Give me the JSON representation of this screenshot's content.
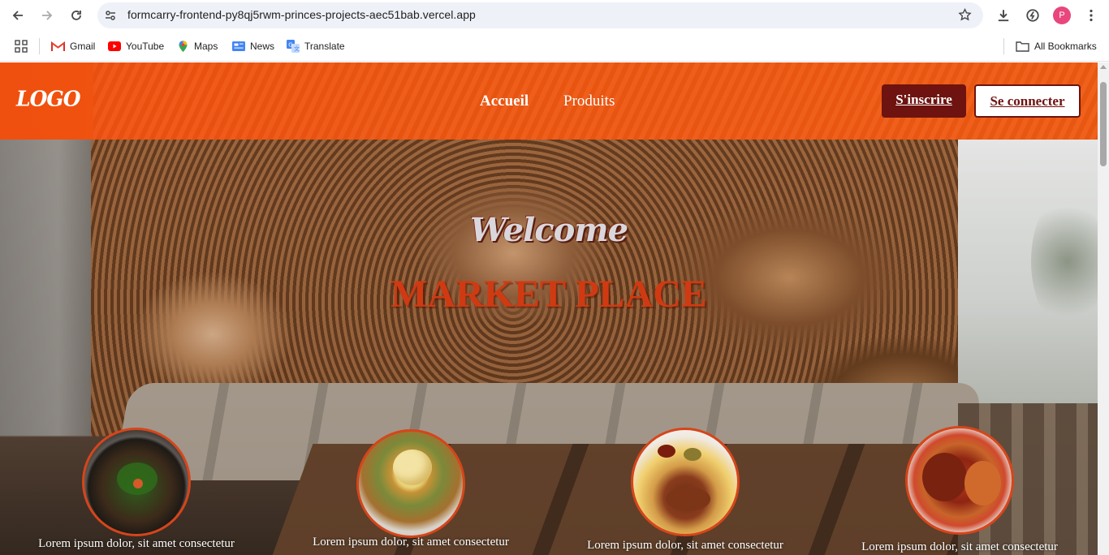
{
  "browser": {
    "url": "formcarry-frontend-py8qj5rwm-princes-projects-aec51bab.vercel.app",
    "profile_initial": "P",
    "bookmarks": [
      {
        "label": "Gmail",
        "icon": "gmail-icon"
      },
      {
        "label": "YouTube",
        "icon": "youtube-icon"
      },
      {
        "label": "Maps",
        "icon": "maps-icon"
      },
      {
        "label": "News",
        "icon": "news-icon"
      },
      {
        "label": "Translate",
        "icon": "translate-icon"
      }
    ],
    "all_bookmarks_label": "All Bookmarks"
  },
  "site": {
    "logo": "LOGO",
    "nav": {
      "home": "Accueil",
      "products": "Produits"
    },
    "signup_label": "S'inscrire",
    "login_label": "Se connecter",
    "hero": {
      "welcome": "Welcome",
      "title": "MARKET PLACE"
    },
    "products": [
      {
        "caption": "Lorem ipsum dolor, sit amet consectetur"
      },
      {
        "caption": "Lorem ipsum dolor, sit amet consectetur"
      },
      {
        "caption": "Lorem ipsum dolor, sit amet consectetur"
      },
      {
        "caption": "Lorem ipsum dolor, sit amet consectetur"
      }
    ]
  },
  "colors": {
    "header_orange": "#f0500f",
    "signup_bg": "#6e1310",
    "title_red": "#d03a12",
    "plate_border": "#d6451a"
  }
}
